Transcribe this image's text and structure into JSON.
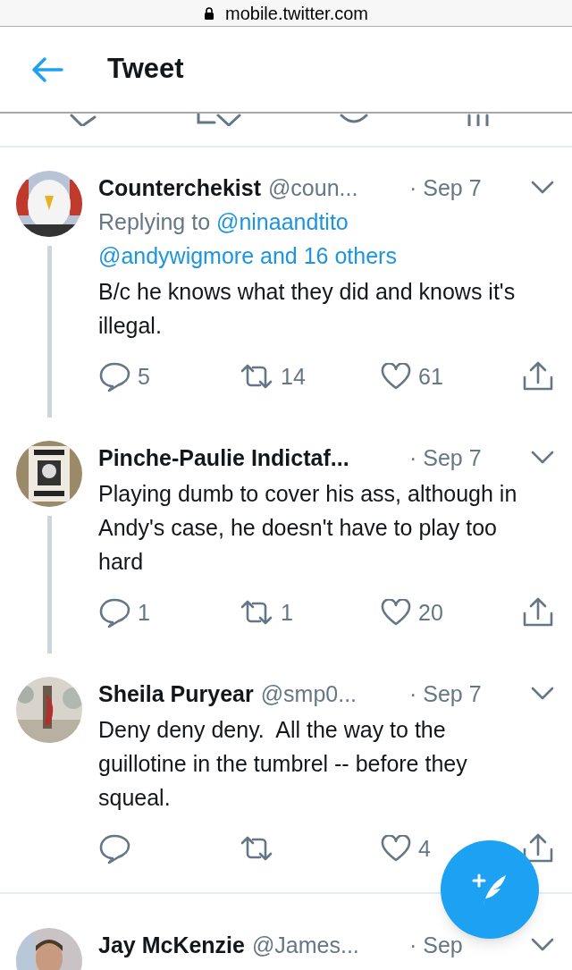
{
  "browser": {
    "url": "mobile.twitter.com"
  },
  "header": {
    "title": "Tweet"
  },
  "tweets": [
    {
      "name": "Counterchekist",
      "handle": "@coun...",
      "date": "· Sep 7",
      "replying_to": {
        "prefix": "Replying to",
        "mentions": [
          "@ninaandtito",
          "@andywigmore and 16 others"
        ]
      },
      "text": "B/c he knows what they did and knows it's illegal.",
      "actions": {
        "replies": "5",
        "retweets": "14",
        "likes": "61"
      },
      "thread_continues": true
    },
    {
      "name": "Pinche-Paulie Indictaf...",
      "date": "· Sep 7",
      "text": "Playing dumb to cover his ass, although in Andy's case, he doesn't have to play too hard",
      "actions": {
        "replies": "1",
        "retweets": "1",
        "likes": "20"
      },
      "thread_continues": true
    },
    {
      "name": "Sheila Puryear",
      "handle": "@smp0...",
      "date": "· Sep 7",
      "text": "Deny deny deny.  All the way to the guillotine in the tumbrel -- before they squeal.",
      "actions": {
        "likes": "4"
      },
      "thread_continues": false
    },
    {
      "name": "Jay McKenzie",
      "handle": "@James...",
      "date": "· Sep",
      "thread_continues": false
    }
  ]
}
